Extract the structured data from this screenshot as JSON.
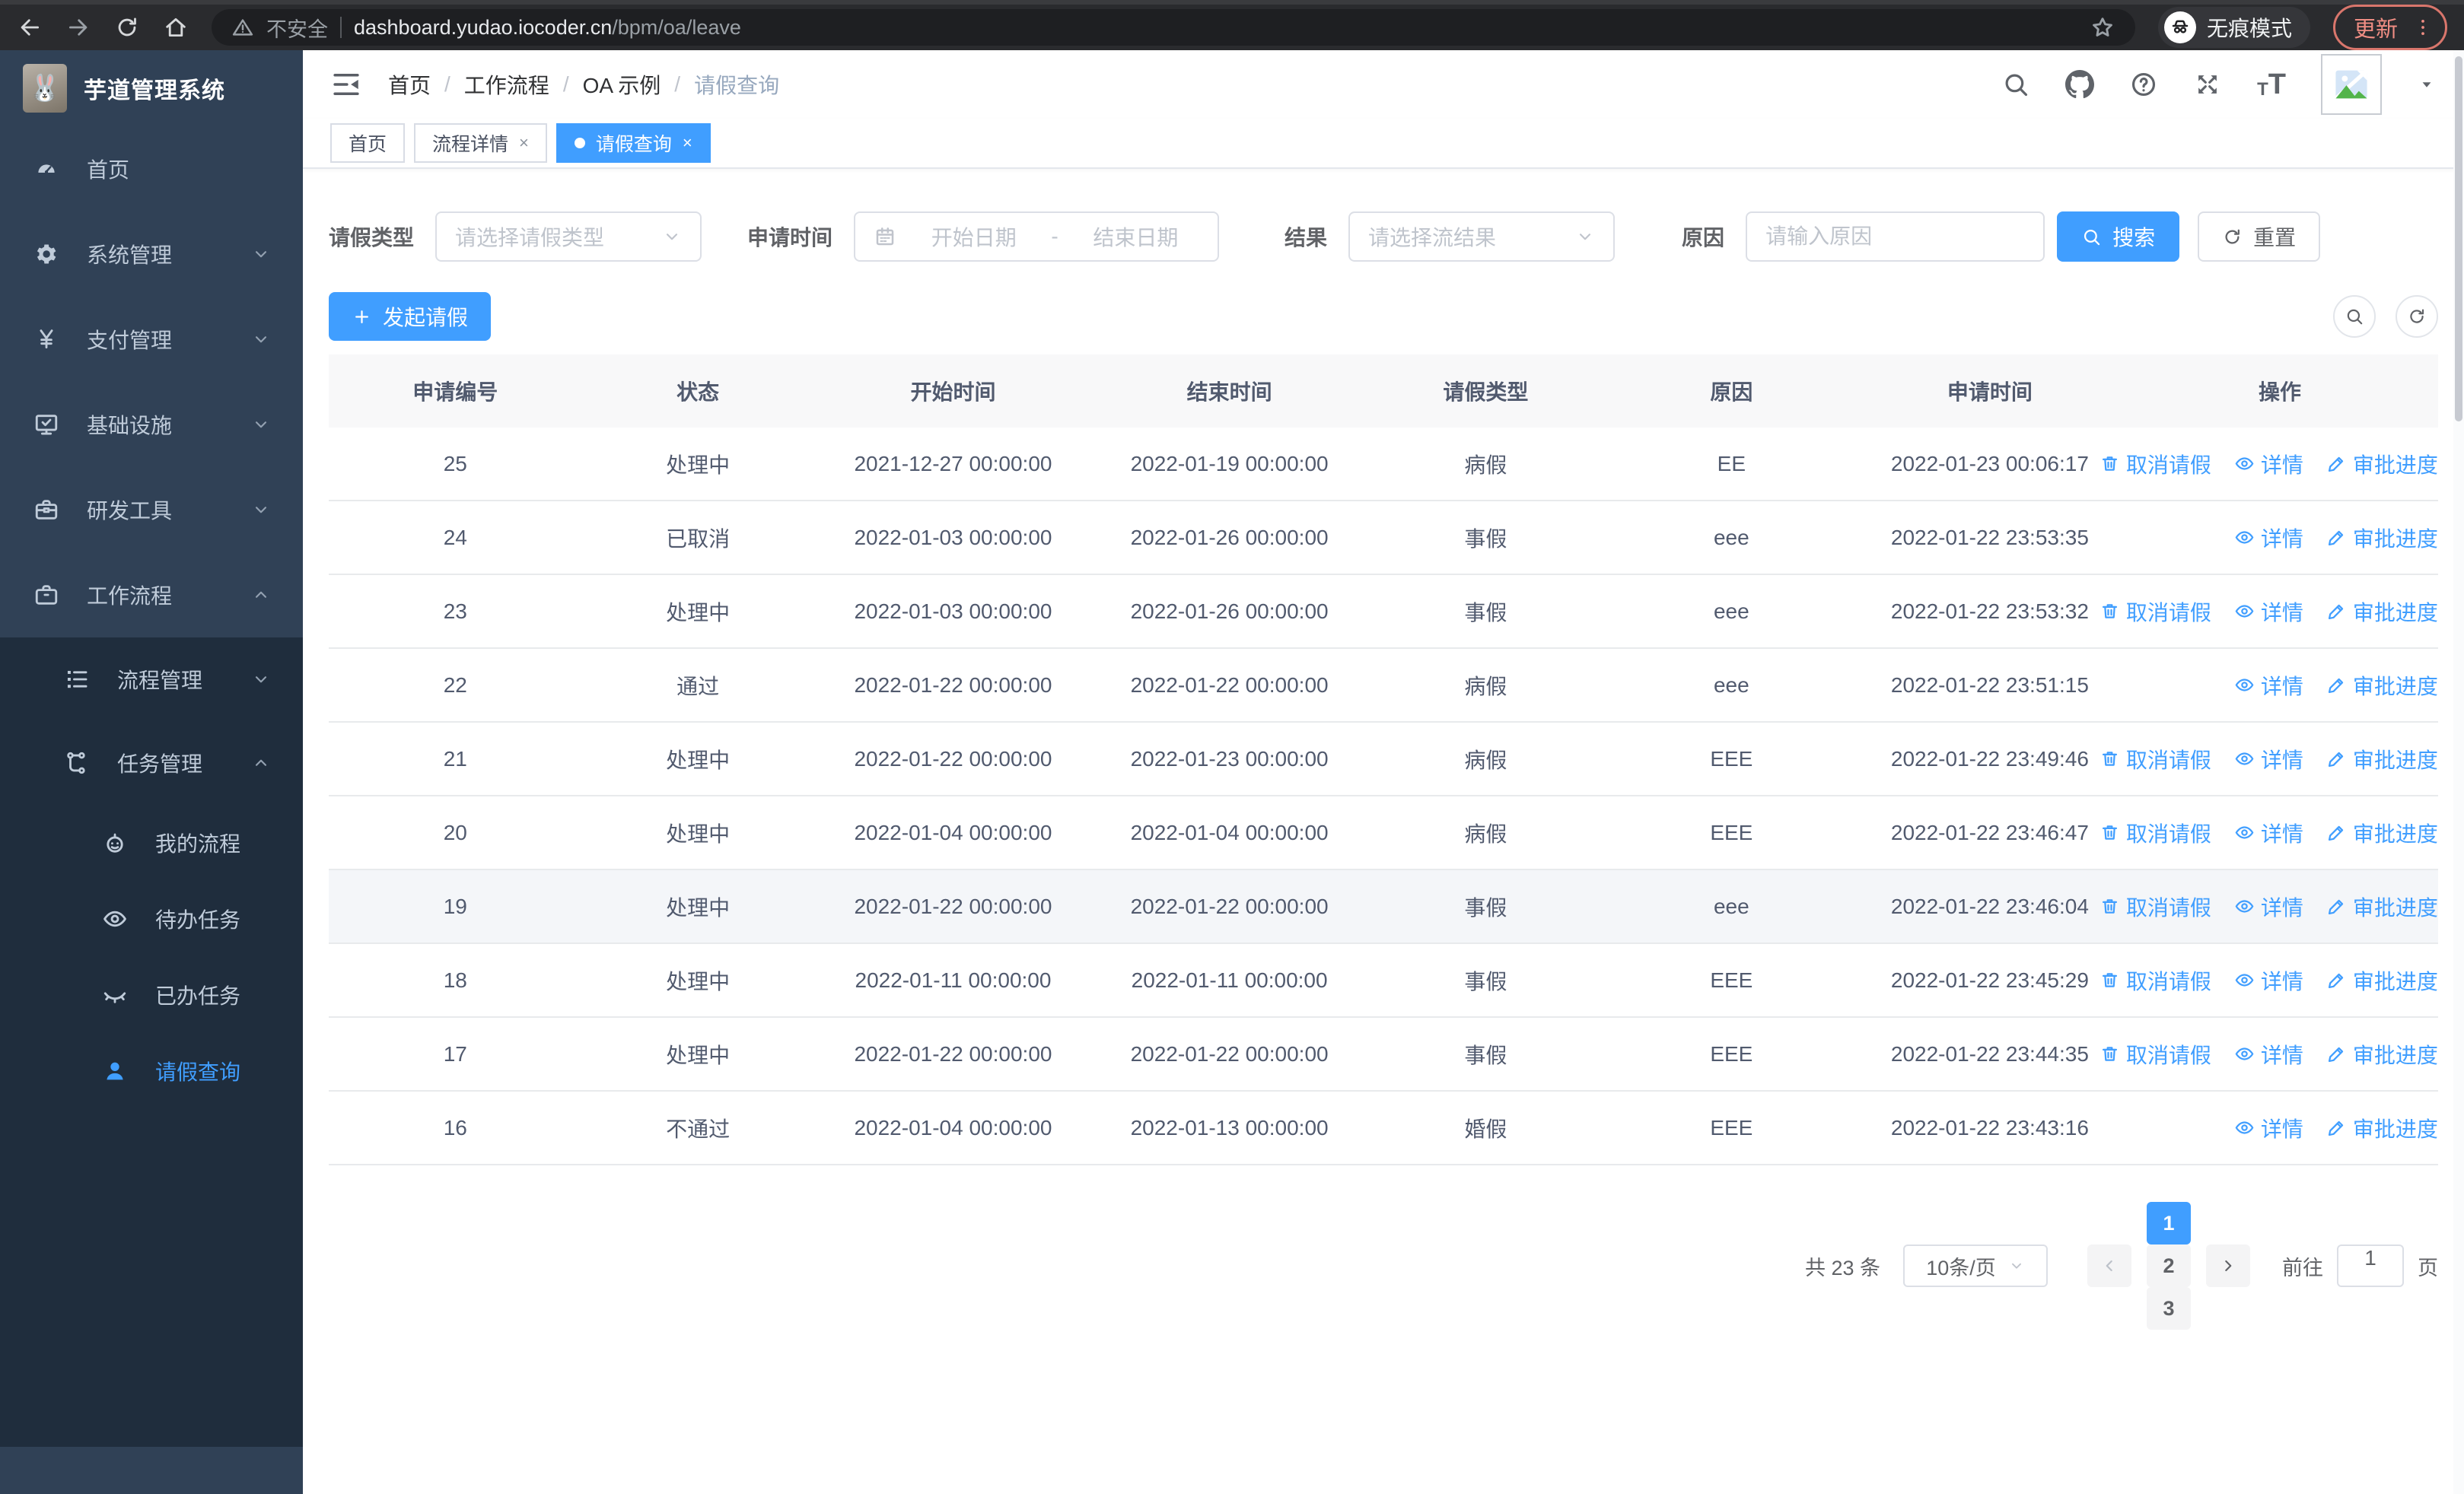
{
  "browser": {
    "security_label": "不安全",
    "url_domain": "dashboard.yudao.iocoder.cn",
    "url_path": "/bpm/oa/leave",
    "incognito_label": "无痕模式",
    "update_label": "更新"
  },
  "sidebar": {
    "logo_title": "芋道管理系统",
    "menu": [
      {
        "key": "home",
        "label": "首页",
        "icon": "dashboard-icon",
        "type": "item"
      },
      {
        "key": "system",
        "label": "系统管理",
        "icon": "gear-icon",
        "type": "group",
        "state": "collapsed"
      },
      {
        "key": "payment",
        "label": "支付管理",
        "icon": "yen-icon",
        "type": "group",
        "state": "collapsed"
      },
      {
        "key": "infra",
        "label": "基础设施",
        "icon": "monitor-icon",
        "type": "group",
        "state": "collapsed"
      },
      {
        "key": "devtools",
        "label": "研发工具",
        "icon": "toolbox-icon",
        "type": "group",
        "state": "collapsed"
      },
      {
        "key": "workflow",
        "label": "工作流程",
        "icon": "briefcase-icon",
        "type": "group",
        "state": "expanded",
        "children": [
          {
            "key": "process-mgmt",
            "label": "流程管理",
            "icon": "list-icon",
            "type": "group",
            "state": "collapsed"
          },
          {
            "key": "task-mgmt",
            "label": "任务管理",
            "icon": "flow-icon",
            "type": "group",
            "state": "expanded",
            "children": [
              {
                "key": "my-process",
                "label": "我的流程",
                "icon": "robot-icon"
              },
              {
                "key": "todo-tasks",
                "label": "待办任务",
                "icon": "eye-icon"
              },
              {
                "key": "done-tasks",
                "label": "已办任务",
                "icon": "eye-closed-icon"
              },
              {
                "key": "leave-query",
                "label": "请假查询",
                "icon": "user-icon",
                "active": true
              }
            ]
          }
        ]
      }
    ]
  },
  "header": {
    "breadcrumb": [
      "首页",
      "工作流程",
      "OA 示例",
      "请假查询"
    ]
  },
  "tabs": [
    {
      "key": "home",
      "label": "首页",
      "closable": false,
      "active": false
    },
    {
      "key": "process-detail",
      "label": "流程详情",
      "closable": true,
      "active": false
    },
    {
      "key": "leave-query",
      "label": "请假查询",
      "closable": true,
      "active": true
    }
  ],
  "filters": {
    "leave_type_label": "请假类型",
    "leave_type_placeholder": "请选择请假类型",
    "apply_time_label": "申请时间",
    "start_placeholder": "开始日期",
    "range_separator": "-",
    "end_placeholder": "结束日期",
    "result_label": "结果",
    "result_placeholder": "请选择流结果",
    "reason_label": "原因",
    "reason_placeholder": "请输入原因",
    "search_label": "搜索",
    "reset_label": "重置"
  },
  "toolbar": {
    "create_label": "发起请假"
  },
  "table": {
    "columns": [
      "申请编号",
      "状态",
      "开始时间",
      "结束时间",
      "请假类型",
      "原因",
      "申请时间",
      "操作"
    ],
    "action_labels": {
      "cancel": "取消请假",
      "detail": "详情",
      "progress": "审批进度"
    },
    "rows": [
      {
        "id": "25",
        "status": "处理中",
        "start": "2021-12-27 00:00:00",
        "end": "2022-01-19 00:00:00",
        "type": "病假",
        "reason": "EE",
        "apply_time": "2022-01-23 00:06:17",
        "actions": [
          "cancel",
          "detail",
          "progress"
        ],
        "highlight": false
      },
      {
        "id": "24",
        "status": "已取消",
        "start": "2022-01-03 00:00:00",
        "end": "2022-01-26 00:00:00",
        "type": "事假",
        "reason": "eee",
        "apply_time": "2022-01-22 23:53:35",
        "actions": [
          "detail",
          "progress"
        ],
        "highlight": false
      },
      {
        "id": "23",
        "status": "处理中",
        "start": "2022-01-03 00:00:00",
        "end": "2022-01-26 00:00:00",
        "type": "事假",
        "reason": "eee",
        "apply_time": "2022-01-22 23:53:32",
        "actions": [
          "cancel",
          "detail",
          "progress"
        ],
        "highlight": false
      },
      {
        "id": "22",
        "status": "通过",
        "start": "2022-01-22 00:00:00",
        "end": "2022-01-22 00:00:00",
        "type": "病假",
        "reason": "eee",
        "apply_time": "2022-01-22 23:51:15",
        "actions": [
          "detail",
          "progress"
        ],
        "highlight": false
      },
      {
        "id": "21",
        "status": "处理中",
        "start": "2022-01-22 00:00:00",
        "end": "2022-01-23 00:00:00",
        "type": "病假",
        "reason": "EEE",
        "apply_time": "2022-01-22 23:49:46",
        "actions": [
          "cancel",
          "detail",
          "progress"
        ],
        "highlight": false
      },
      {
        "id": "20",
        "status": "处理中",
        "start": "2022-01-04 00:00:00",
        "end": "2022-01-04 00:00:00",
        "type": "病假",
        "reason": "EEE",
        "apply_time": "2022-01-22 23:46:47",
        "actions": [
          "cancel",
          "detail",
          "progress"
        ],
        "highlight": false
      },
      {
        "id": "19",
        "status": "处理中",
        "start": "2022-01-22 00:00:00",
        "end": "2022-01-22 00:00:00",
        "type": "事假",
        "reason": "eee",
        "apply_time": "2022-01-22 23:46:04",
        "actions": [
          "cancel",
          "detail",
          "progress"
        ],
        "highlight": true
      },
      {
        "id": "18",
        "status": "处理中",
        "start": "2022-01-11 00:00:00",
        "end": "2022-01-11 00:00:00",
        "type": "事假",
        "reason": "EEE",
        "apply_time": "2022-01-22 23:45:29",
        "actions": [
          "cancel",
          "detail",
          "progress"
        ],
        "highlight": false
      },
      {
        "id": "17",
        "status": "处理中",
        "start": "2022-01-22 00:00:00",
        "end": "2022-01-22 00:00:00",
        "type": "事假",
        "reason": "EEE",
        "apply_time": "2022-01-22 23:44:35",
        "actions": [
          "cancel",
          "detail",
          "progress"
        ],
        "highlight": false
      },
      {
        "id": "16",
        "status": "不通过",
        "start": "2022-01-04 00:00:00",
        "end": "2022-01-13 00:00:00",
        "type": "婚假",
        "reason": "EEE",
        "apply_time": "2022-01-22 23:43:16",
        "actions": [
          "detail",
          "progress"
        ],
        "highlight": false
      }
    ]
  },
  "pagination": {
    "total_label": "共 23 条",
    "page_size_label": "10条/页",
    "pages": [
      "1",
      "2",
      "3"
    ],
    "active_page": "1",
    "goto_label": "前往",
    "goto_value": "1",
    "page_unit_label": "页"
  },
  "colors": {
    "primary": "#409eff",
    "sidebar_bg": "#304156",
    "submenu_bg": "#1f2d3d",
    "update_accent": "#e8827a"
  }
}
